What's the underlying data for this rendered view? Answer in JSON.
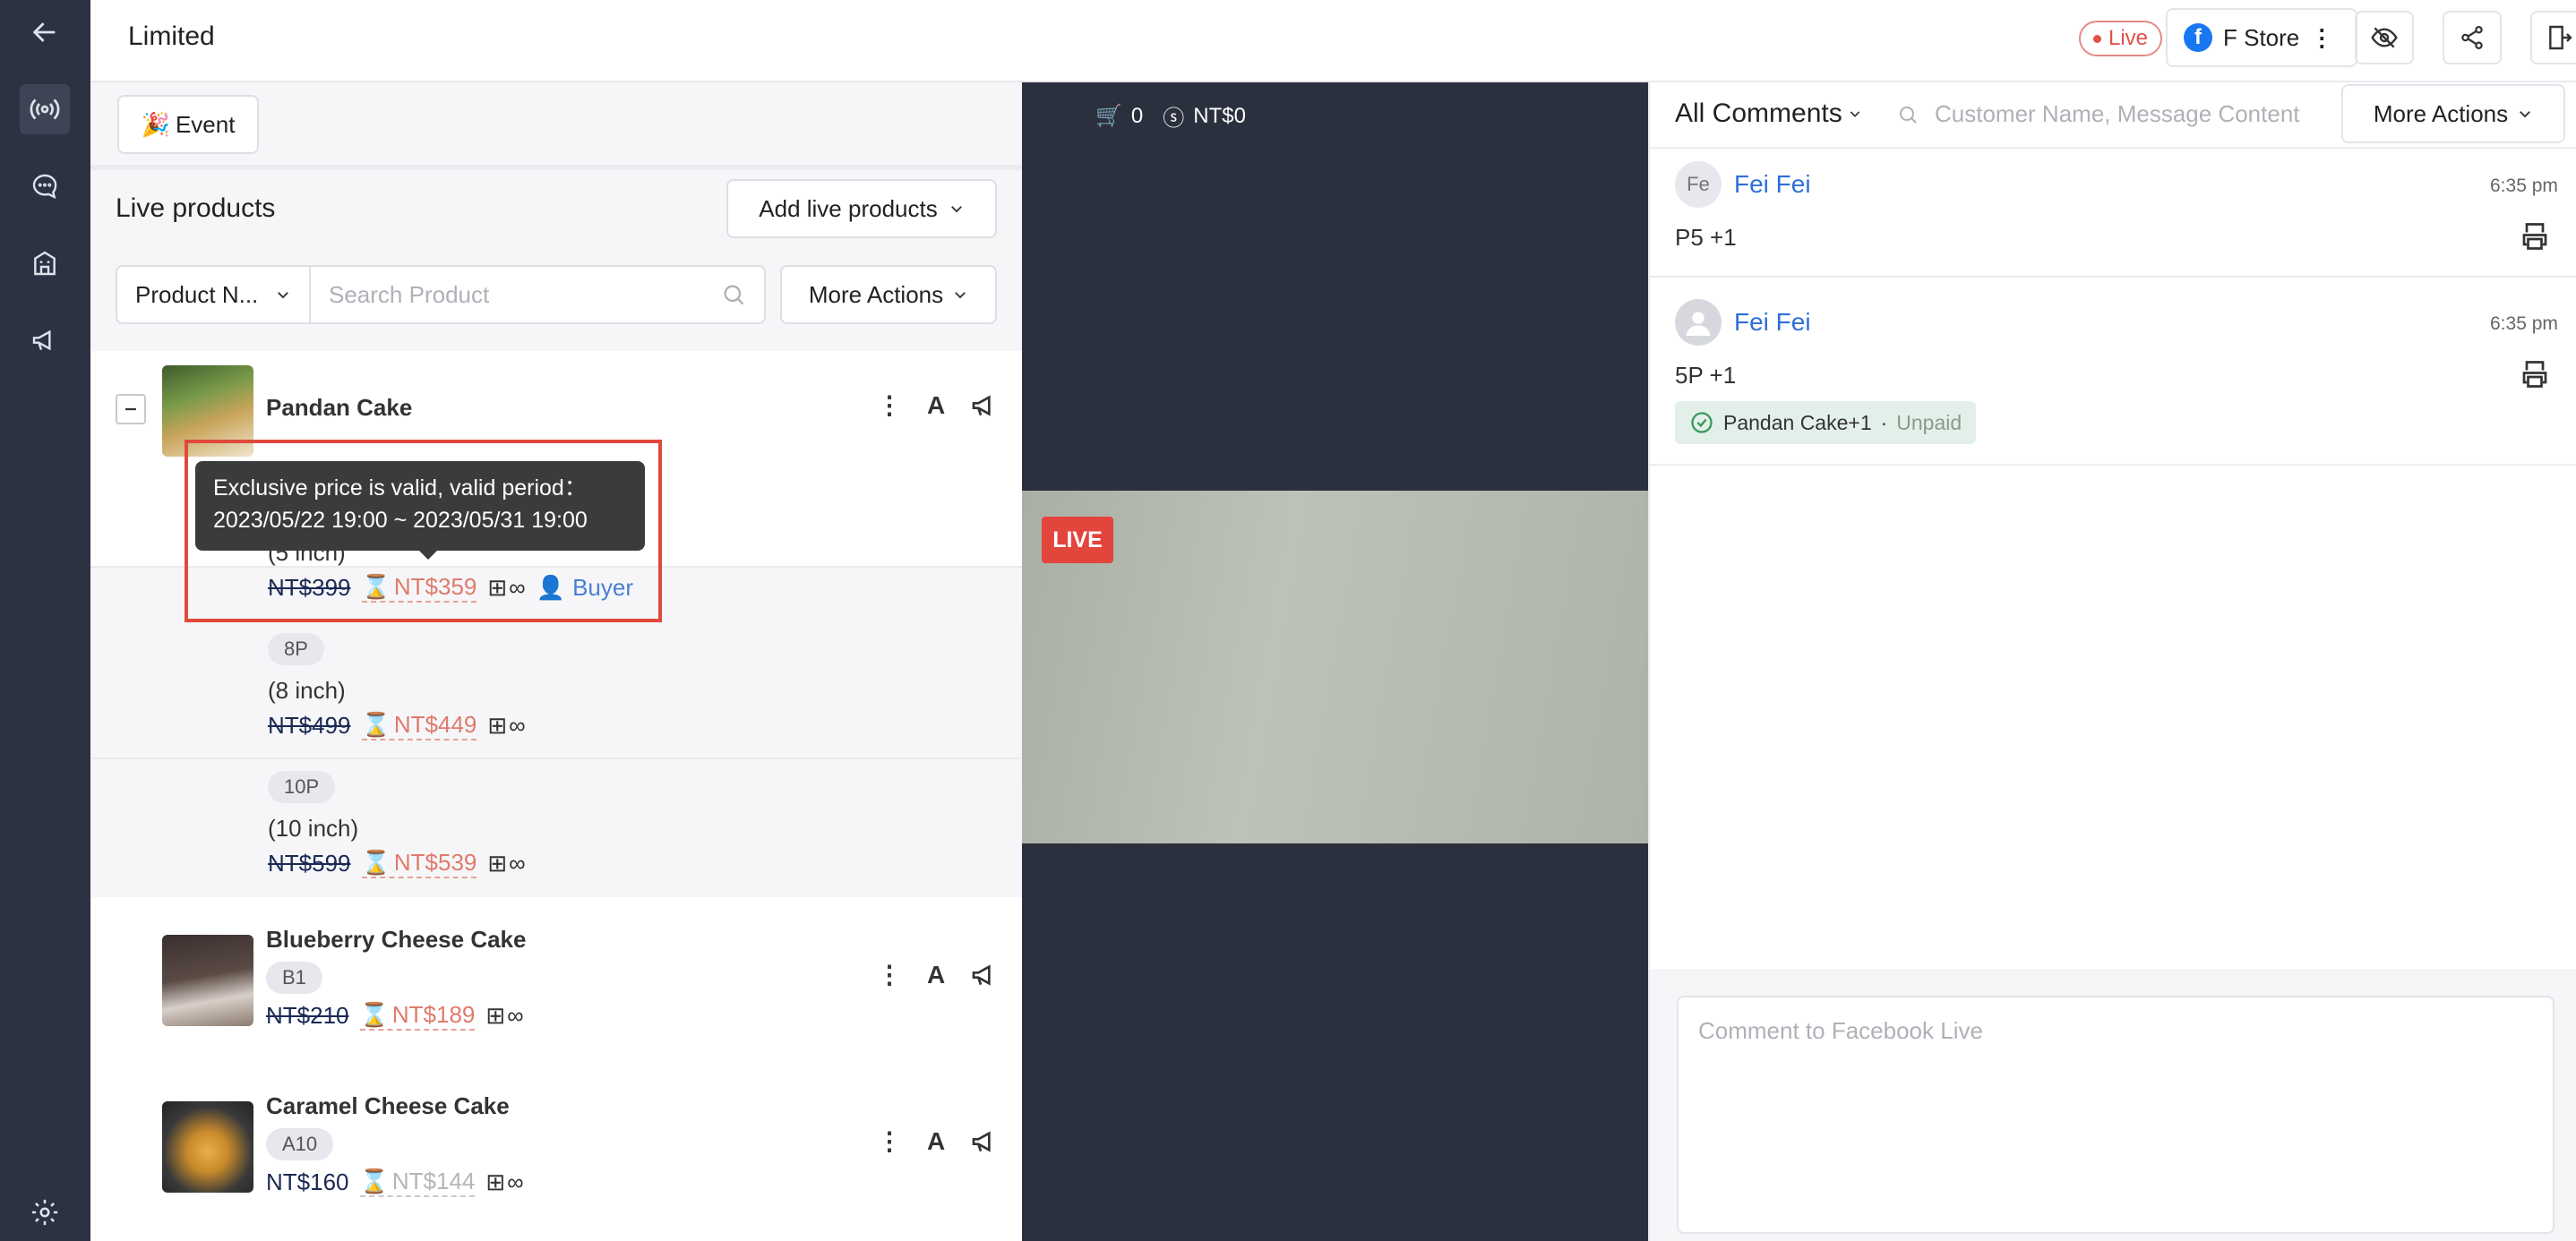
{
  "header": {
    "title": "Limited",
    "live_label": "Live",
    "store_name": "F Store"
  },
  "event_button": {
    "label": "Event"
  },
  "live_products": {
    "title": "Live products",
    "add_label": "Add live products",
    "filter_label": "Product N...",
    "search_placeholder": "Search Product",
    "more_actions": "More Actions"
  },
  "tooltip": {
    "line1": "Exclusive price is valid, valid period：",
    "line2": "2023/05/22 19:00 ~ 2023/05/31 19:00"
  },
  "products": [
    {
      "name": "Pandan Cake",
      "variants": [
        {
          "tag": "",
          "size": "(5 inch)",
          "orig": "NT$399",
          "sale": "NT$359",
          "stock": "∞",
          "buyer": "Buyer"
        },
        {
          "tag": "8P",
          "size": "(8 inch)",
          "orig": "NT$499",
          "sale": "NT$449",
          "stock": "∞"
        },
        {
          "tag": "10P",
          "size": "(10 inch)",
          "orig": "NT$599",
          "sale": "NT$539",
          "stock": "∞"
        }
      ]
    },
    {
      "name": "Blueberry Cheese Cake",
      "tag": "B1",
      "orig": "NT$210",
      "sale": "NT$189",
      "stock": "∞"
    },
    {
      "name": "Caramel Cheese Cake",
      "tag": "A10",
      "orig": "NT$160",
      "sale": "NT$144",
      "stock": "∞"
    }
  ],
  "stream": {
    "live_tag": "LIVE",
    "cart_count": "0",
    "total": "NT$0"
  },
  "comments": {
    "filter_label": "All Comments",
    "search_placeholder": "Customer Name, Message Content",
    "more_actions": "More Actions",
    "items": [
      {
        "avatar": "Fe",
        "name": "Fei Fei",
        "time": "6:35 pm",
        "text": "P5 +1"
      },
      {
        "avatar": "",
        "name": "Fei Fei",
        "time": "6:35 pm",
        "text": "5P +1",
        "order_item": "Pandan Cake+1",
        "order_status": "Unpaid"
      }
    ],
    "reply_placeholder": "Comment to Facebook Live"
  },
  "colors": {
    "sidebar": "#2c3242",
    "accent_red": "#e04a3c",
    "link_blue": "#2e6fd8",
    "sale": "#e07a6c"
  }
}
